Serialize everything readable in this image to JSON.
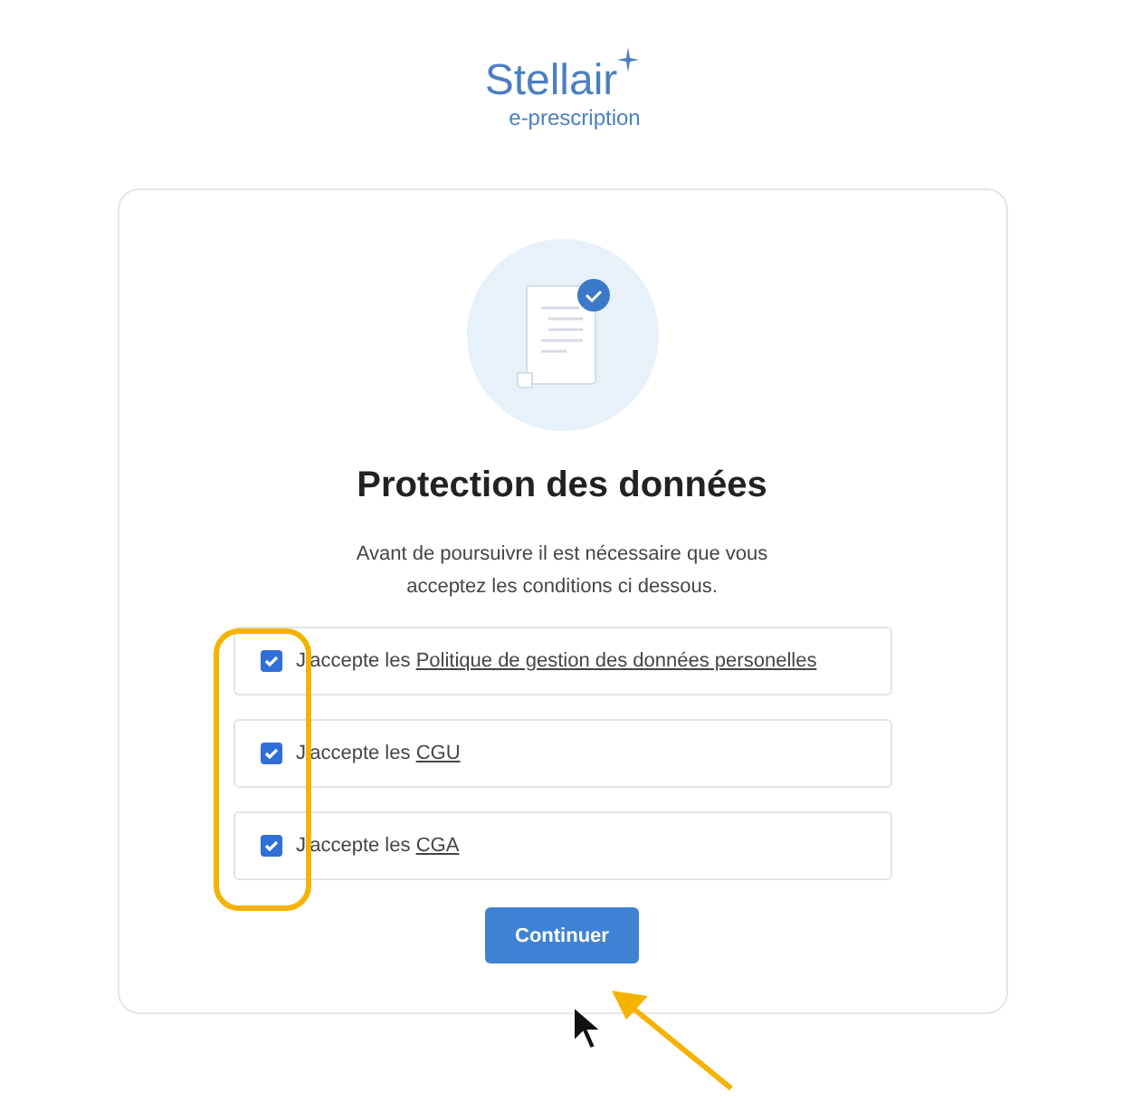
{
  "logo": {
    "name": "Stellair",
    "subtitle": "e-prescription"
  },
  "title": "Protection des données",
  "intro": "Avant de poursuivre il est nécessaire que vous acceptez les conditions ci dessous.",
  "consents": [
    {
      "prefix": "J'accepte les",
      "link": "Politique de gestion des données personelles",
      "checked": true
    },
    {
      "prefix": "J'accepte les",
      "link": "CGU",
      "checked": true
    },
    {
      "prefix": "J'accepte les",
      "link": "CGA",
      "checked": true
    }
  ],
  "button": "Continuer"
}
